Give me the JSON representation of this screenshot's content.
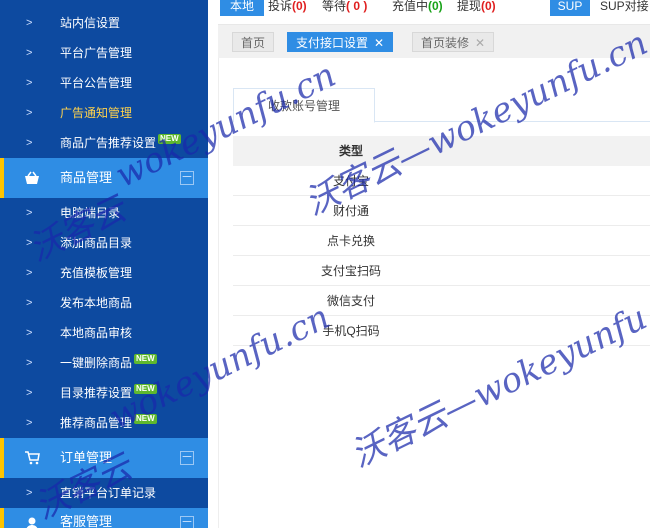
{
  "sidebar": {
    "items_top": [
      {
        "label": "站内信设置",
        "badge": ""
      },
      {
        "label": "平台广告管理",
        "badge": ""
      },
      {
        "label": "平台公告管理",
        "badge": ""
      },
      {
        "label": "广告通知管理",
        "badge": "",
        "active": true
      },
      {
        "label": "商品广告推荐设置",
        "badge": "NEW"
      }
    ],
    "group_goods": {
      "label": "商品管理",
      "collapse": "－"
    },
    "items_goods": [
      {
        "label": "电脑端目录",
        "badge": ""
      },
      {
        "label": "添加商品目录",
        "badge": ""
      },
      {
        "label": "充值模板管理",
        "badge": ""
      },
      {
        "label": "发布本地商品",
        "badge": ""
      },
      {
        "label": "本地商品审核",
        "badge": ""
      },
      {
        "label": "一键删除商品",
        "badge": "NEW"
      },
      {
        "label": "目录推荐设置",
        "badge": "NEW"
      },
      {
        "label": "推荐商品管理",
        "badge": "NEW"
      }
    ],
    "group_orders": {
      "label": "订单管理",
      "collapse": "－"
    },
    "items_orders": [
      {
        "label": "直销平台订单记录",
        "badge": ""
      }
    ],
    "group_service": {
      "label": "客服管理",
      "collapse": "－"
    }
  },
  "topbar": {
    "local_tab": "本地",
    "complaint_label": "投诉",
    "complaint_count": "(0)",
    "waiting_label": "等待",
    "waiting_count": "( 0 )",
    "recharging_label": "充值中",
    "recharging_count": "(0)",
    "withdraw_label": "提现",
    "withdraw_count": "(0)",
    "sup_button": "SUP",
    "sup_text": "SUP对接"
  },
  "page_tabs": [
    {
      "label": "首页",
      "closable": false,
      "active": false
    },
    {
      "label": "支付接口设置",
      "closable": true,
      "active": true
    },
    {
      "label": "首页装修",
      "closable": true,
      "active": false
    }
  ],
  "panel": {
    "tab_label": "收款账号管理",
    "table": {
      "header": "类型",
      "rows": [
        "支付宝",
        "财付通",
        "点卡兑换",
        "支付宝扫码",
        "微信支付",
        "手机Q扫码"
      ]
    }
  },
  "watermark": {
    "text_domain": "wokeyunfu.cn",
    "text_cn": "沃客云",
    "text_full": "沃客云—wokeyunfu.cn"
  },
  "colors": {
    "sidebar_bg": "#0d4aa0",
    "group_bg": "#2f8de4",
    "accent_bar": "#ffc400",
    "active_item_text": "#ffd24d",
    "badge_green": "#5fb82e",
    "count_red": "#e02020",
    "count_green": "#1aa31a"
  }
}
